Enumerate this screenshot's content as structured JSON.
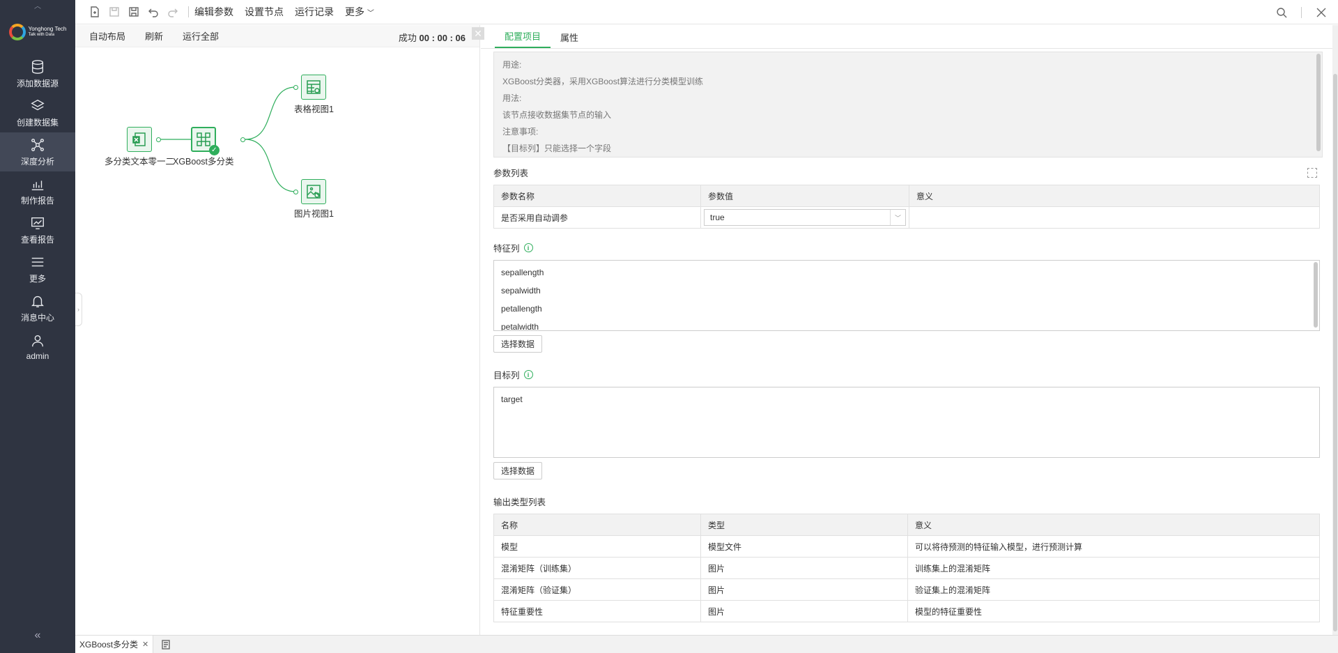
{
  "sidebar": {
    "logo_line1": "Yonghong Tech",
    "logo_line2": "Talk with Data",
    "items": [
      {
        "label": "添加数据源",
        "icon": "database-icon",
        "active": false
      },
      {
        "label": "创建数据集",
        "icon": "layers-icon",
        "active": false
      },
      {
        "label": "深度分析",
        "icon": "network-icon",
        "active": true
      },
      {
        "label": "制作报告",
        "icon": "bar-chart-icon",
        "active": false
      },
      {
        "label": "查看报告",
        "icon": "monitor-chart-icon",
        "active": false
      },
      {
        "label": "更多",
        "icon": "menu-icon",
        "active": false
      },
      {
        "label": "消息中心",
        "icon": "bell-icon",
        "active": false
      },
      {
        "label": "admin",
        "icon": "user-icon",
        "active": false
      }
    ],
    "collapse_glyph": "«"
  },
  "toolbar": {
    "edit_params": "编辑参数",
    "set_node": "设置节点",
    "run_log": "运行记录",
    "more": "更多"
  },
  "canvas": {
    "auto_layout": "自动布局",
    "refresh": "刷新",
    "run_all": "运行全部",
    "status_label": "成功",
    "status_time": "00 : 00 : 06",
    "nodes": {
      "source": "多分类文本零一二",
      "xgb": "XGBoost多分类",
      "table_view": "表格视图1",
      "image_view": "图片视图1"
    }
  },
  "panel": {
    "tabs": [
      "配置项目",
      "属性"
    ],
    "description": [
      "用途:",
      "XGBoost分类器，采用XGBoost算法进行分类模型训练",
      "用法:",
      "该节点接收数据集节点的输入",
      "注意事项:",
      "【目标列】只能选择一个字段"
    ],
    "param_title": "参数列表",
    "param_headers": [
      "参数名称",
      "参数值",
      "意义"
    ],
    "param_rows": [
      {
        "name": "是否采用自动调参",
        "value": "true",
        "meaning": ""
      }
    ],
    "feature_title": "特征列",
    "features": [
      "sepallength",
      "sepalwidth",
      "petallength",
      "petalwidth"
    ],
    "select_data": "选择数据",
    "target_title": "目标列",
    "targets": [
      "target"
    ],
    "output_title": "输出类型列表",
    "output_headers": [
      "名称",
      "类型",
      "意义"
    ],
    "output_rows": [
      [
        "模型",
        "模型文件",
        "可以将待预测的特征输入模型，进行预测计算"
      ],
      [
        "混淆矩阵（训练集）",
        "图片",
        "训练集上的混淆矩阵"
      ],
      [
        "混淆矩阵（验证集）",
        "图片",
        "验证集上的混淆矩阵"
      ],
      [
        "特征重要性",
        "图片",
        "模型的特征重要性"
      ]
    ]
  },
  "bottom_tab": {
    "label": "XGBoost多分类"
  },
  "colors": {
    "accent": "#2fae5c",
    "sidebar_bg": "#2f3441"
  }
}
